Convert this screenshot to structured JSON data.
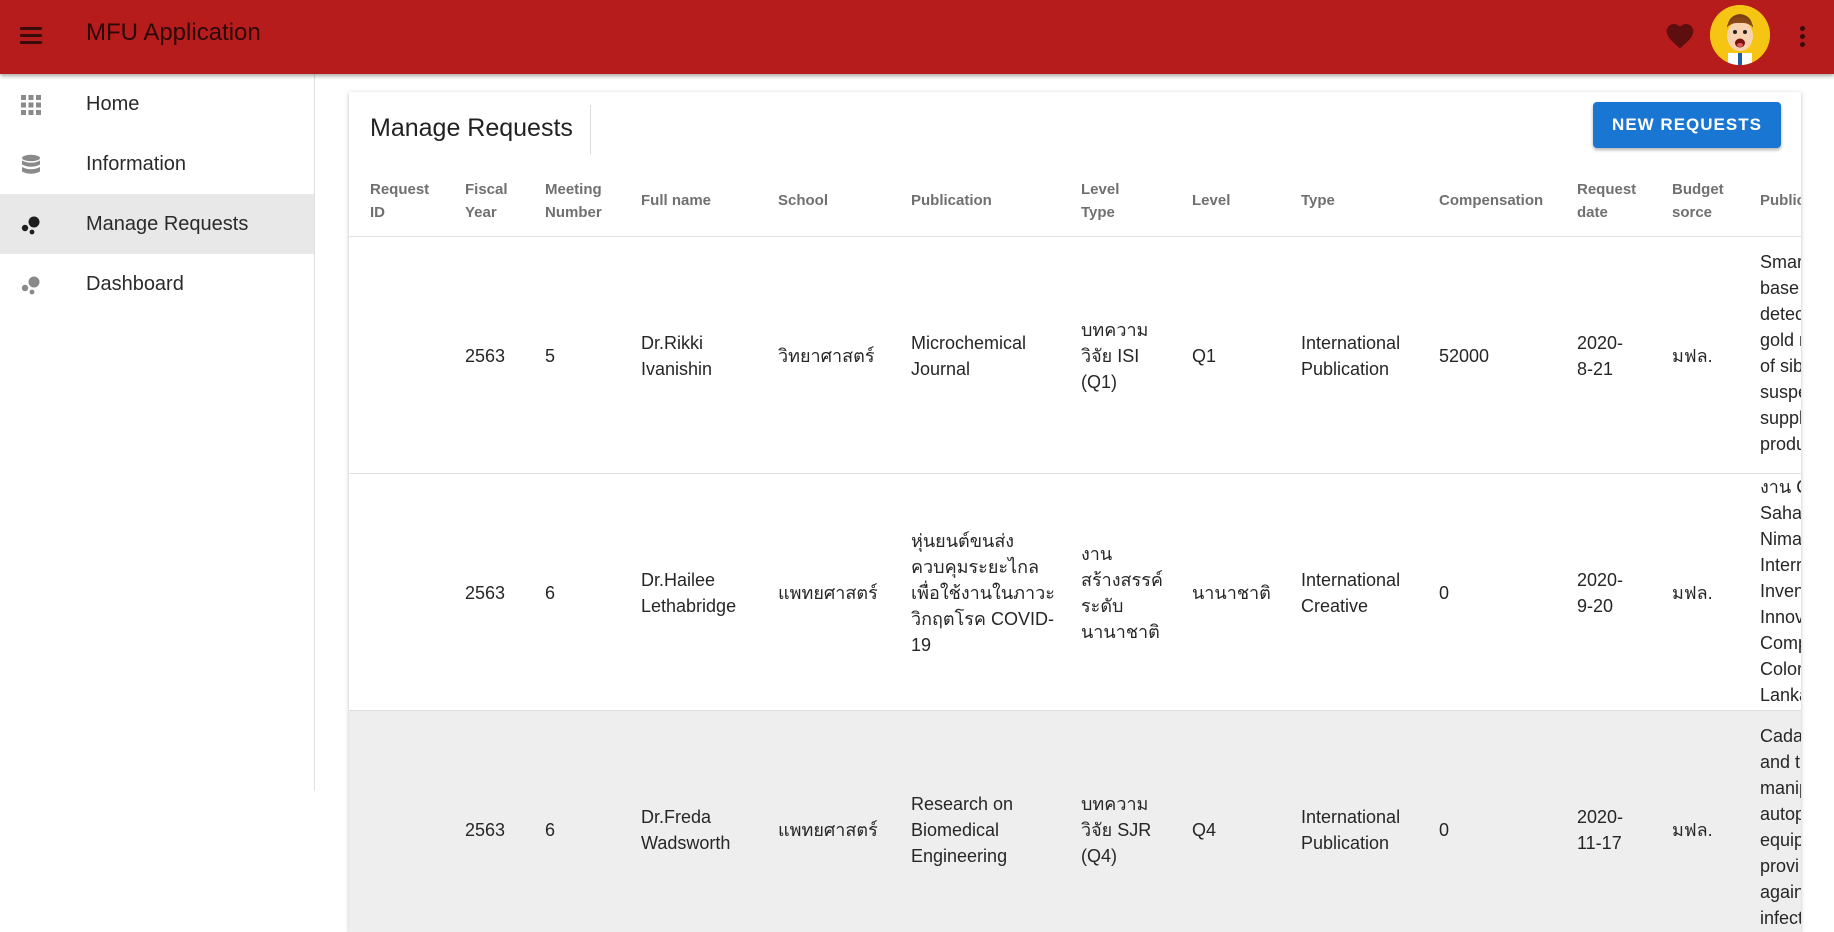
{
  "app": {
    "title": "MFU Application"
  },
  "sidebar": {
    "items": [
      {
        "label": "Home",
        "icon": "grid-icon"
      },
      {
        "label": "Information",
        "icon": "database-icon"
      },
      {
        "label": "Manage Requests",
        "icon": "bubbles-icon",
        "active": true
      },
      {
        "label": "Dashboard",
        "icon": "bubbles-icon"
      }
    ]
  },
  "main": {
    "title": "Manage Requests",
    "new_button": "NEW REQUESTS",
    "columns": [
      "Request ID",
      "Fiscal Year",
      "Meeting Number",
      "Full name",
      "School",
      "Publication",
      "Level Type",
      "Level",
      "Type",
      "Compensation",
      "Request date",
      "Budget sorce",
      "Public"
    ],
    "rows": [
      {
        "request_id": "",
        "fiscal_year": "2563",
        "meeting_number": "5",
        "full_name": "Dr.Rikki Ivanishin",
        "school": "วิทยาศาสตร์",
        "publication": "Microchemical Journal",
        "level_type": "บทความ วิจัย ISI (Q1)",
        "level": "Q1",
        "type": "International Publication",
        "compensation": "52000",
        "request_date": "2020-8-21",
        "budget_source": "มฟล.",
        "public": "Smar\nbase\ndetec\ngold n\nof sib\nsuspe\nsuppl\nprodu"
      },
      {
        "request_id": "",
        "fiscal_year": "2563",
        "meeting_number": "6",
        "full_name": "Dr.Hailee Lethabridge",
        "school": "แพทยศาสตร์",
        "publication": "หุ่นยนต์ขนส่ง ควบคุมระยะไกล เพื่อใช้งานในภาวะ วิกฤตโรค COVID-19",
        "level_type": "งาน สร้างสรรค์ ระดับ นานาชาติ",
        "level": "นานาชาติ",
        "type": "International Creative",
        "compensation": "0",
        "request_date": "2020-9-20",
        "budget_source": "มฟล.",
        "public": "งาน C\nSaha\nNima\nInterr\nInven\nInnov\nComp\nColor\nLanka"
      },
      {
        "request_id": "",
        "fiscal_year": "2563",
        "meeting_number": "6",
        "full_name": "Dr.Freda Wadsworth",
        "school": "แพทยศาสตร์",
        "publication": "Research on Biomedical Engineering",
        "level_type": "บทความ วิจัย SJR (Q4)",
        "level": "Q4",
        "type": "International Publication",
        "compensation": "0",
        "request_date": "2020-11-17",
        "budget_source": "มฟล.",
        "public": "Cada\nand t\nmanip\nautop\nequip\nprovi\nagain\ninfect",
        "highlighted": true
      }
    ]
  },
  "colors": {
    "appbar": "#b71c1c",
    "primary_button": "#1976d2",
    "avatar_bg": "#f6c514",
    "heart": "#5d0e0e"
  }
}
